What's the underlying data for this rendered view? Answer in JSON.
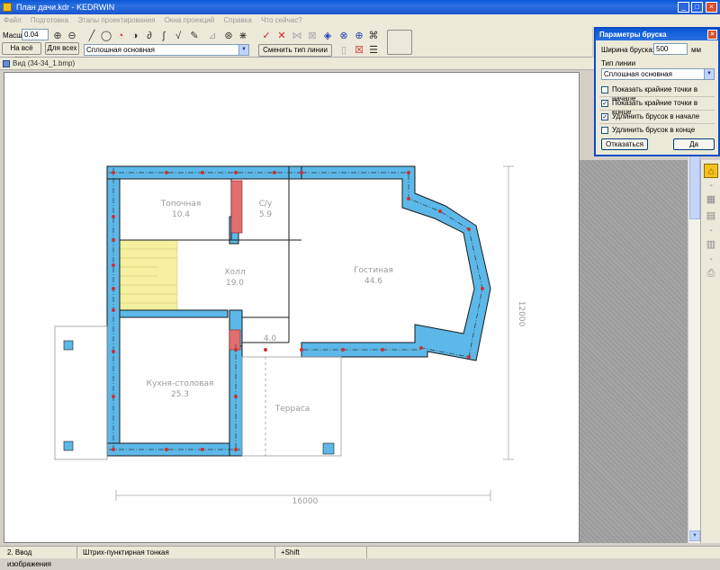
{
  "window": {
    "title": "План дачи.kdr - KEDRWIN",
    "minimize": "_",
    "maximize": "□",
    "close": "×"
  },
  "menu": [
    "Файл",
    "Подготовка",
    "Этапы проектирования",
    "Окна проекций",
    "Справка",
    "Что сейчас?"
  ],
  "toolbar": {
    "scale_label": "Масшт",
    "scale_value": "0.04",
    "fit_window_button": "На всё окно",
    "fit_all_button": "Для всех",
    "line_type_value": "Сплошная основная",
    "change_line_type_button": "Сменить тип линии"
  },
  "document": {
    "tab_title": "Вид (34-34_1.bmp)"
  },
  "plan": {
    "rooms": [
      {
        "name": "Топочная",
        "area": "10.4"
      },
      {
        "name": "С/у",
        "area": "5.9"
      },
      {
        "name": "Холл",
        "area": "19.0"
      },
      {
        "name": "Гостиная",
        "area": "44.6"
      },
      {
        "name": "4.0",
        "area": ""
      },
      {
        "name": "Кухня-столовая",
        "area": "25.3"
      },
      {
        "name": "Терраса",
        "area": ""
      }
    ],
    "dim_horizontal": "16000",
    "dim_vertical": "12000",
    "wall_color": "#5cb8e8",
    "stair_color": "#f4f0a0"
  },
  "dialog": {
    "title": "Параметры бруска",
    "width_label": "Ширина бруска:",
    "width_value": "500",
    "width_unit": "мм",
    "line_type_label": "Тип линии",
    "line_type_value": "Сплошная основная",
    "options": [
      {
        "label": "Показать крайние точки в начале",
        "checked": false
      },
      {
        "label": "Показать крайние точки в конце",
        "checked": true
      },
      {
        "label": "Удлинить брусок в начале",
        "checked": true
      },
      {
        "label": "Удлинить брусок в конце",
        "checked": false
      }
    ],
    "cancel_button": "Отказаться",
    "ok_button": "Да"
  },
  "status": {
    "mode": "2. Ввод изображения",
    "line_type": "Штрих-пунктирная тонкая",
    "hint": "+Shift"
  }
}
